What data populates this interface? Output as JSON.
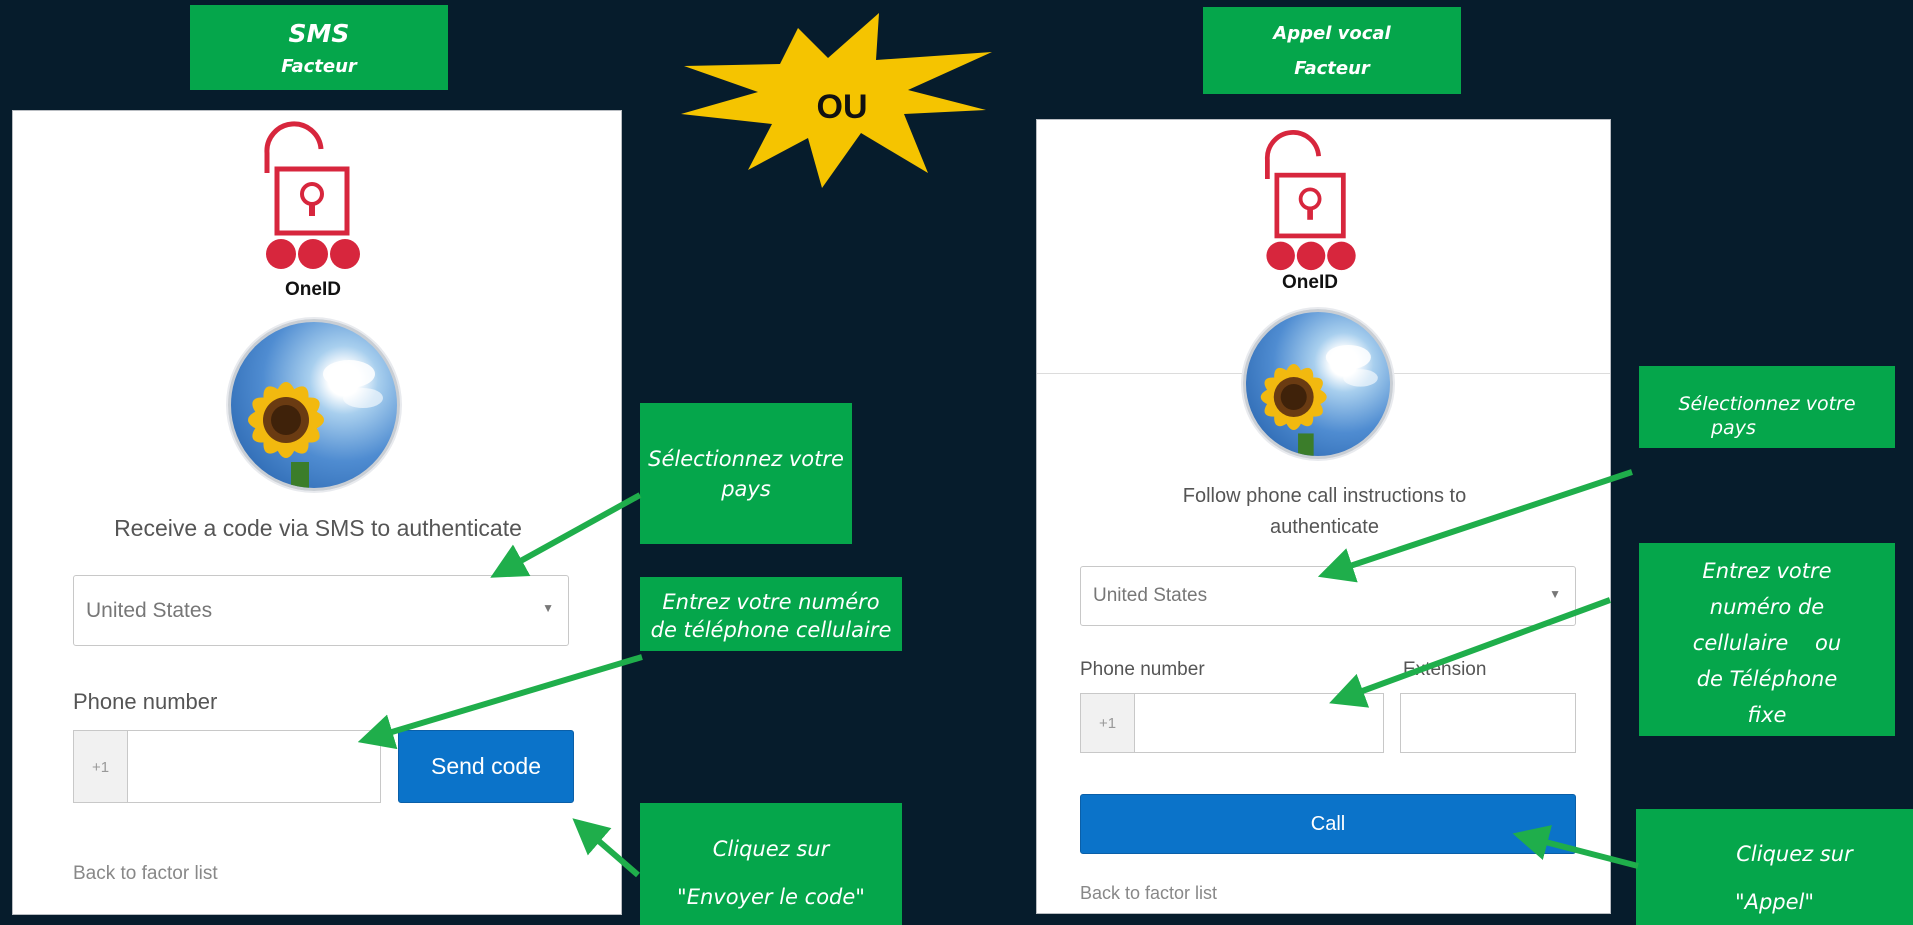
{
  "colors": {
    "background": "#061c2c",
    "tag_green": "#05a64b",
    "arrow_green": "#1fae4b",
    "starburst": "#f5c400",
    "onid_red": "#d7263d",
    "button_blue": "#0b73c9"
  },
  "header": {
    "sms_title": "SMS",
    "sms_subtitle": "Facteur",
    "or_text": "OU",
    "voice_title": "Appel vocal",
    "voice_subtitle": "Facteur"
  },
  "sms_card": {
    "brand": "OneID",
    "prompt": "Receive a code via SMS to authenticate",
    "country_value": "United States",
    "phone_label": "Phone number",
    "phone_prefix": "+1",
    "phone_value": "",
    "send_button": "Send code",
    "back_link": "Back to factor list"
  },
  "voice_card": {
    "brand": "OneID",
    "prompt_line1": "Follow phone call instructions to",
    "prompt_line2": "authenticate",
    "country_value": "United States",
    "phone_label": "Phone number",
    "extension_label": "Extension",
    "phone_prefix": "+1",
    "phone_value": "",
    "extension_value": "",
    "call_button": "Call",
    "back_link": "Back to factor list"
  },
  "annotations": {
    "sms_country_line1": "Sélectionnez votre",
    "sms_country_line2": "pays",
    "sms_phone_line1": "Entrez votre numéro",
    "sms_phone_line2": "de téléphone cellulaire",
    "sms_click_line1": "Cliquez sur",
    "sms_click_line2": "\"Envoyer le code\"",
    "voice_country_line1": "Sélectionnez votre",
    "voice_country_line2": "pays",
    "voice_phone_line1": "Entrez votre",
    "voice_phone_line2": "numéro de",
    "voice_phone_line3": "cellulaire    ou",
    "voice_phone_line4": "de Téléphone",
    "voice_phone_line5": "fixe",
    "voice_click_line1": "Cliquez sur",
    "voice_click_line2": "\"Appel\""
  }
}
